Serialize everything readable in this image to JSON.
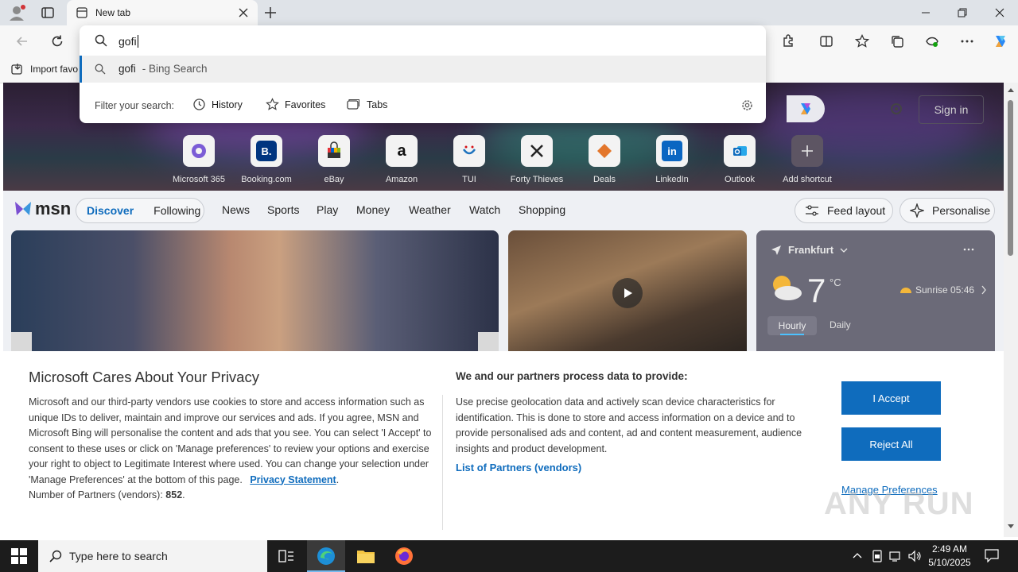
{
  "browser": {
    "tab_title": "New tab",
    "address_value": "gofi",
    "favorites_import": "Import favo"
  },
  "dropdown": {
    "suggestion_query": "gofi",
    "suggestion_suffix": " - Bing Search",
    "filter_label": "Filter your search:",
    "filters": [
      "History",
      "Favorites",
      "Tabs"
    ]
  },
  "page": {
    "sign_in": "Sign in",
    "shortcuts": [
      "Microsoft 365",
      "Booking.com",
      "eBay",
      "Amazon",
      "TUI",
      "Forty Thieves",
      "Deals",
      "LinkedIn",
      "Outlook",
      "Add shortcut"
    ],
    "msn_logo": "msn",
    "tabs": [
      "Discover",
      "Following"
    ],
    "nav": [
      "News",
      "Sports",
      "Play",
      "Money",
      "Weather",
      "Watch",
      "Shopping"
    ],
    "feed_layout": "Feed layout",
    "personalise": "Personalise",
    "weather": {
      "city": "Frankfurt",
      "temp": "7",
      "unit": "°C",
      "sunrise": "Sunrise 05:46",
      "hourly": "Hourly",
      "daily": "Daily"
    }
  },
  "privacy": {
    "title": "Microsoft Cares About Your Privacy",
    "body": "Microsoft and our third-party vendors use cookies to store and access information such as unique IDs to deliver, maintain and improve our services and ads. If you agree, MSN and Microsoft Bing will personalise the content and ads that you see. You can select 'I Accept' to consent to these uses or click on 'Manage preferences' to review your options and exercise your right to object to Legitimate Interest where used.  You can change your selection under 'Manage Preferences' at the bottom of this page.",
    "statement_link": "Privacy Statement",
    "partners_count_label": "Number of Partners (vendors):",
    "partners_count": "852",
    "right_title": "We and our partners process data to provide:",
    "right_body": "Use precise geolocation data and actively scan device characteristics for identification. This is done to store and access information on a device and to provide personalised ads and content, ad and content measurement, audience insights and product development.",
    "partners_link": "List of Partners (vendors)",
    "accept": "I Accept",
    "reject": "Reject All",
    "manage": "Manage Preferences"
  },
  "watermark": "ANY RUN",
  "taskbar": {
    "search_placeholder": "Type here to search",
    "time": "2:49 AM",
    "date": "5/10/2025"
  },
  "colors": {
    "accent": "#0f6cbd",
    "taskbar": "#1c1c1c"
  }
}
